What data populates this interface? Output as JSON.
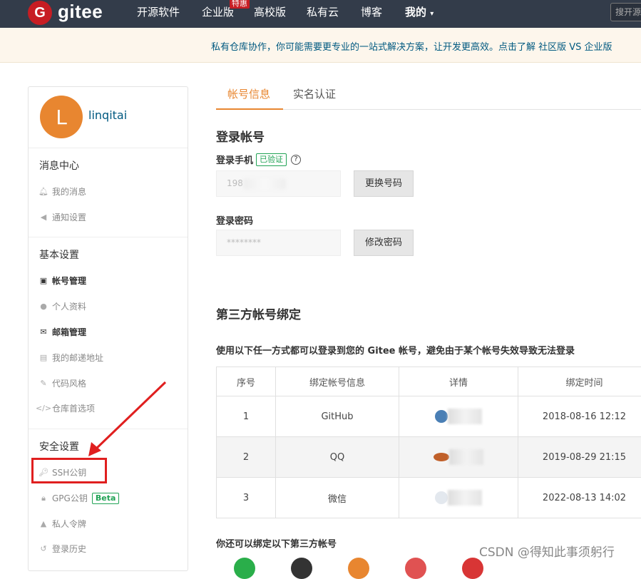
{
  "nav": {
    "logo_letter": "G",
    "logo_text": "gitee",
    "items": [
      "开源软件",
      "企业版",
      "高校版",
      "私有云",
      "博客",
      "我的"
    ],
    "hot_badge": "特惠",
    "search_placeholder": "搜开源"
  },
  "banner": {
    "text": "私有仓库协作，你可能需要更专业的一站式解决方案，让开发更高效。点击了解 社区版 VS 企业版"
  },
  "sidebar": {
    "avatar_letter": "L",
    "username": "linqitai",
    "sections": [
      {
        "title": "消息中心",
        "items": [
          {
            "label": "我的消息",
            "icon": "bell-icon"
          },
          {
            "label": "通知设置",
            "icon": "volume-icon"
          }
        ]
      },
      {
        "title": "基本设置",
        "items": [
          {
            "label": "帐号管理",
            "icon": "id-card-icon"
          },
          {
            "label": "个人资料",
            "icon": "user-icon"
          },
          {
            "label": "邮箱管理",
            "icon": "envelope-icon"
          },
          {
            "label": "我的邮递地址",
            "icon": "address-card-icon"
          },
          {
            "label": "代码风格",
            "icon": "brush-icon"
          },
          {
            "label": "仓库首选项",
            "icon": "code-icon"
          }
        ]
      },
      {
        "title": "安全设置",
        "items": [
          {
            "label": "SSH公钥",
            "icon": "key-icon"
          },
          {
            "label": "GPG公钥",
            "icon": "lock-icon",
            "badge": "Beta"
          },
          {
            "label": "私人令牌",
            "icon": "token-icon"
          },
          {
            "label": "登录历史",
            "icon": "history-icon"
          }
        ]
      }
    ]
  },
  "tabs": [
    "帐号信息",
    "实名认证"
  ],
  "login": {
    "heading": "登录帐号",
    "phone_label": "登录手机",
    "verified": "已验证",
    "help": "?",
    "phone_value": "198",
    "change_phone": "更换号码",
    "password_label": "登录密码",
    "password_value": "********",
    "change_password": "修改密码"
  },
  "third_party": {
    "heading": "第三方帐号绑定",
    "desc": "使用以下任一方式都可以登录到您的 Gitee 帐号，避免由于某个帐号失效导致无法登录",
    "columns": [
      "序号",
      "绑定帐号信息",
      "详情",
      "绑定时间"
    ],
    "rows": [
      {
        "index": "1",
        "name": "GitHub",
        "time": "2018-08-16 12:12"
      },
      {
        "index": "2",
        "name": "QQ",
        "time": "2019-08-29 21:15"
      },
      {
        "index": "3",
        "name": "微信",
        "time": "2022-08-13 14:02"
      }
    ],
    "more": "你还可以绑定以下第三方帐号"
  },
  "watermark": "CSDN @得知此事须躬行",
  "colors": {
    "nav_bg": "#333c4a",
    "brand_red": "#c71d23",
    "accent_orange": "#e88630",
    "success_green": "#21a355",
    "annotation_red": "#e01f1f"
  }
}
